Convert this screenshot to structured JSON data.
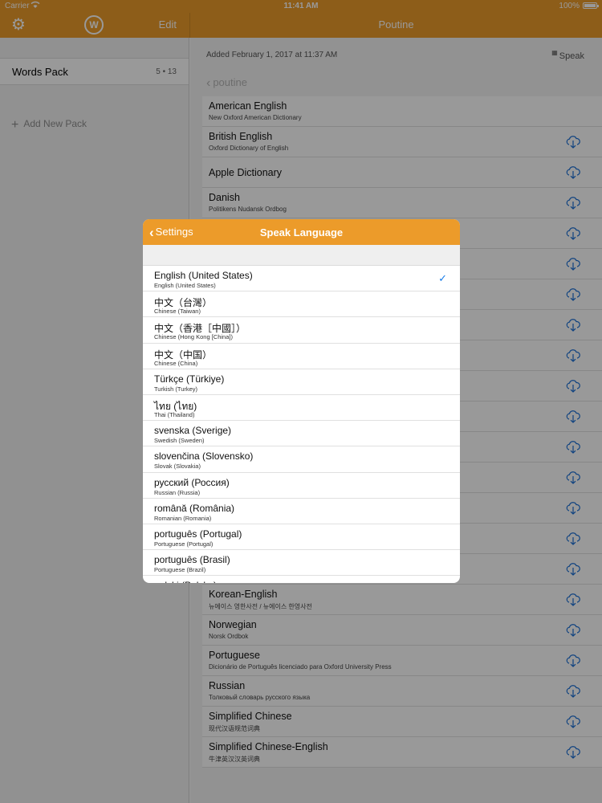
{
  "status": {
    "carrier": "Carrier",
    "time": "11:41 AM",
    "battery": "100%"
  },
  "nav": {
    "edit_label": "Edit",
    "title": "Poutine"
  },
  "sidebar": {
    "pack_name": "Words Pack",
    "pack_count": "5 • 13",
    "add_label": "Add New Pack"
  },
  "main": {
    "added": "Added February 1, 2017 at 11:37 AM",
    "speak_label": "Speak",
    "back_label": "poutine"
  },
  "dictionaries": [
    {
      "title": "American English",
      "subtitle": "New Oxford American Dictionary",
      "download": false
    },
    {
      "title": "British English",
      "subtitle": "Oxford Dictionary of English",
      "download": true
    },
    {
      "title": "Apple Dictionary",
      "subtitle": "",
      "download": true
    },
    {
      "title": "Danish",
      "subtitle": "Politikens Nudansk Ordbog",
      "download": true
    },
    {
      "title": "",
      "subtitle": "",
      "download": true
    },
    {
      "title": "",
      "subtitle": "",
      "download": true
    },
    {
      "title": "",
      "subtitle": "",
      "download": true
    },
    {
      "title": "",
      "subtitle": "",
      "download": true
    },
    {
      "title": "",
      "subtitle": "",
      "download": true
    },
    {
      "title": "",
      "subtitle": "",
      "download": true
    },
    {
      "title": "",
      "subtitle": "",
      "download": true
    },
    {
      "title": "",
      "subtitle": "",
      "download": true
    },
    {
      "title": "",
      "subtitle": "",
      "download": true
    },
    {
      "title": "",
      "subtitle": "",
      "download": true
    },
    {
      "title": "",
      "subtitle": "",
      "download": true
    },
    {
      "title": "",
      "subtitle": "",
      "download": true
    },
    {
      "title": "Korean-English",
      "subtitle": "뉴에이스 영한사전 / 뉴에이스 한영사전",
      "download": true
    },
    {
      "title": "Norwegian",
      "subtitle": "Norsk Ordbok",
      "download": true
    },
    {
      "title": "Portuguese",
      "subtitle": "Dicionário de Português licenciado para Oxford University Press",
      "download": true
    },
    {
      "title": "Russian",
      "subtitle": "Толковый словарь русского языка",
      "download": true
    },
    {
      "title": "Simplified Chinese",
      "subtitle": "现代汉语规范词典",
      "download": true
    },
    {
      "title": "Simplified Chinese-English",
      "subtitle": "牛津英汉汉英词典",
      "download": true
    }
  ],
  "modal": {
    "back_label": "Settings",
    "title": "Speak Language",
    "languages": [
      {
        "native": "English (United States)",
        "english": "English (United States)",
        "selected": true
      },
      {
        "native": "中文（台灣）",
        "english": "Chinese (Taiwan)",
        "selected": false
      },
      {
        "native": "中文（香港［中國］）",
        "english": "Chinese (Hong Kong [China])",
        "selected": false
      },
      {
        "native": "中文（中国）",
        "english": "Chinese (China)",
        "selected": false
      },
      {
        "native": "Türkçe (Türkiye)",
        "english": "Turkish (Turkey)",
        "selected": false
      },
      {
        "native": "ไทย (ไทย)",
        "english": "Thai (Thailand)",
        "selected": false
      },
      {
        "native": "svenska (Sverige)",
        "english": "Swedish (Sweden)",
        "selected": false
      },
      {
        "native": "slovenčina (Slovensko)",
        "english": "Slovak (Slovakia)",
        "selected": false
      },
      {
        "native": "русский (Россия)",
        "english": "Russian (Russia)",
        "selected": false
      },
      {
        "native": "română (România)",
        "english": "Romanian (Romania)",
        "selected": false
      },
      {
        "native": "português (Portugal)",
        "english": "Portuguese (Portugal)",
        "selected": false
      },
      {
        "native": "português (Brasil)",
        "english": "Portuguese (Brazil)",
        "selected": false
      },
      {
        "native": "polski (Polska)",
        "english": "",
        "selected": false
      }
    ]
  },
  "colors": {
    "accent": "#ec9b2a",
    "check": "#1a7de8"
  }
}
